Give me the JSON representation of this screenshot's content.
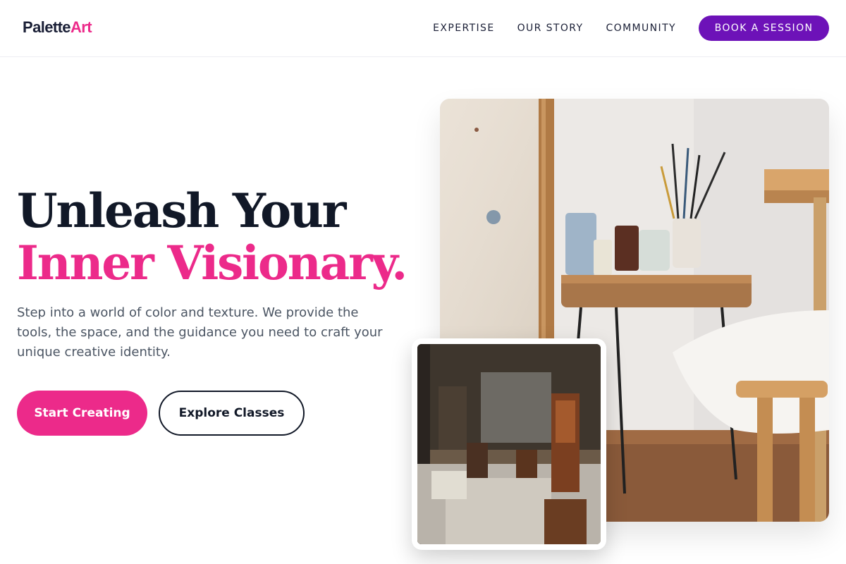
{
  "brand": {
    "name_main": "Palette",
    "name_accent": "Art",
    "accent_color": "#ec2a8a"
  },
  "nav": {
    "links": [
      "EXPERTISE",
      "OUR STORY",
      "COMMUNITY"
    ],
    "cta_label": "BOOK A SESSION",
    "cta_color": "#6d12b8"
  },
  "hero": {
    "title_line1": "Unleash Your",
    "title_line2": "Inner Visionary.",
    "description": "Step into a world of color and texture. We provide the tools, the space, and the guidance you need to craft your unique creative identity.",
    "primary_button": "Start Creating",
    "secondary_button": "Explore Classes"
  },
  "images": {
    "main_icon": "art-studio-table-photo",
    "secondary_icon": "art-workshop-room-photo"
  }
}
